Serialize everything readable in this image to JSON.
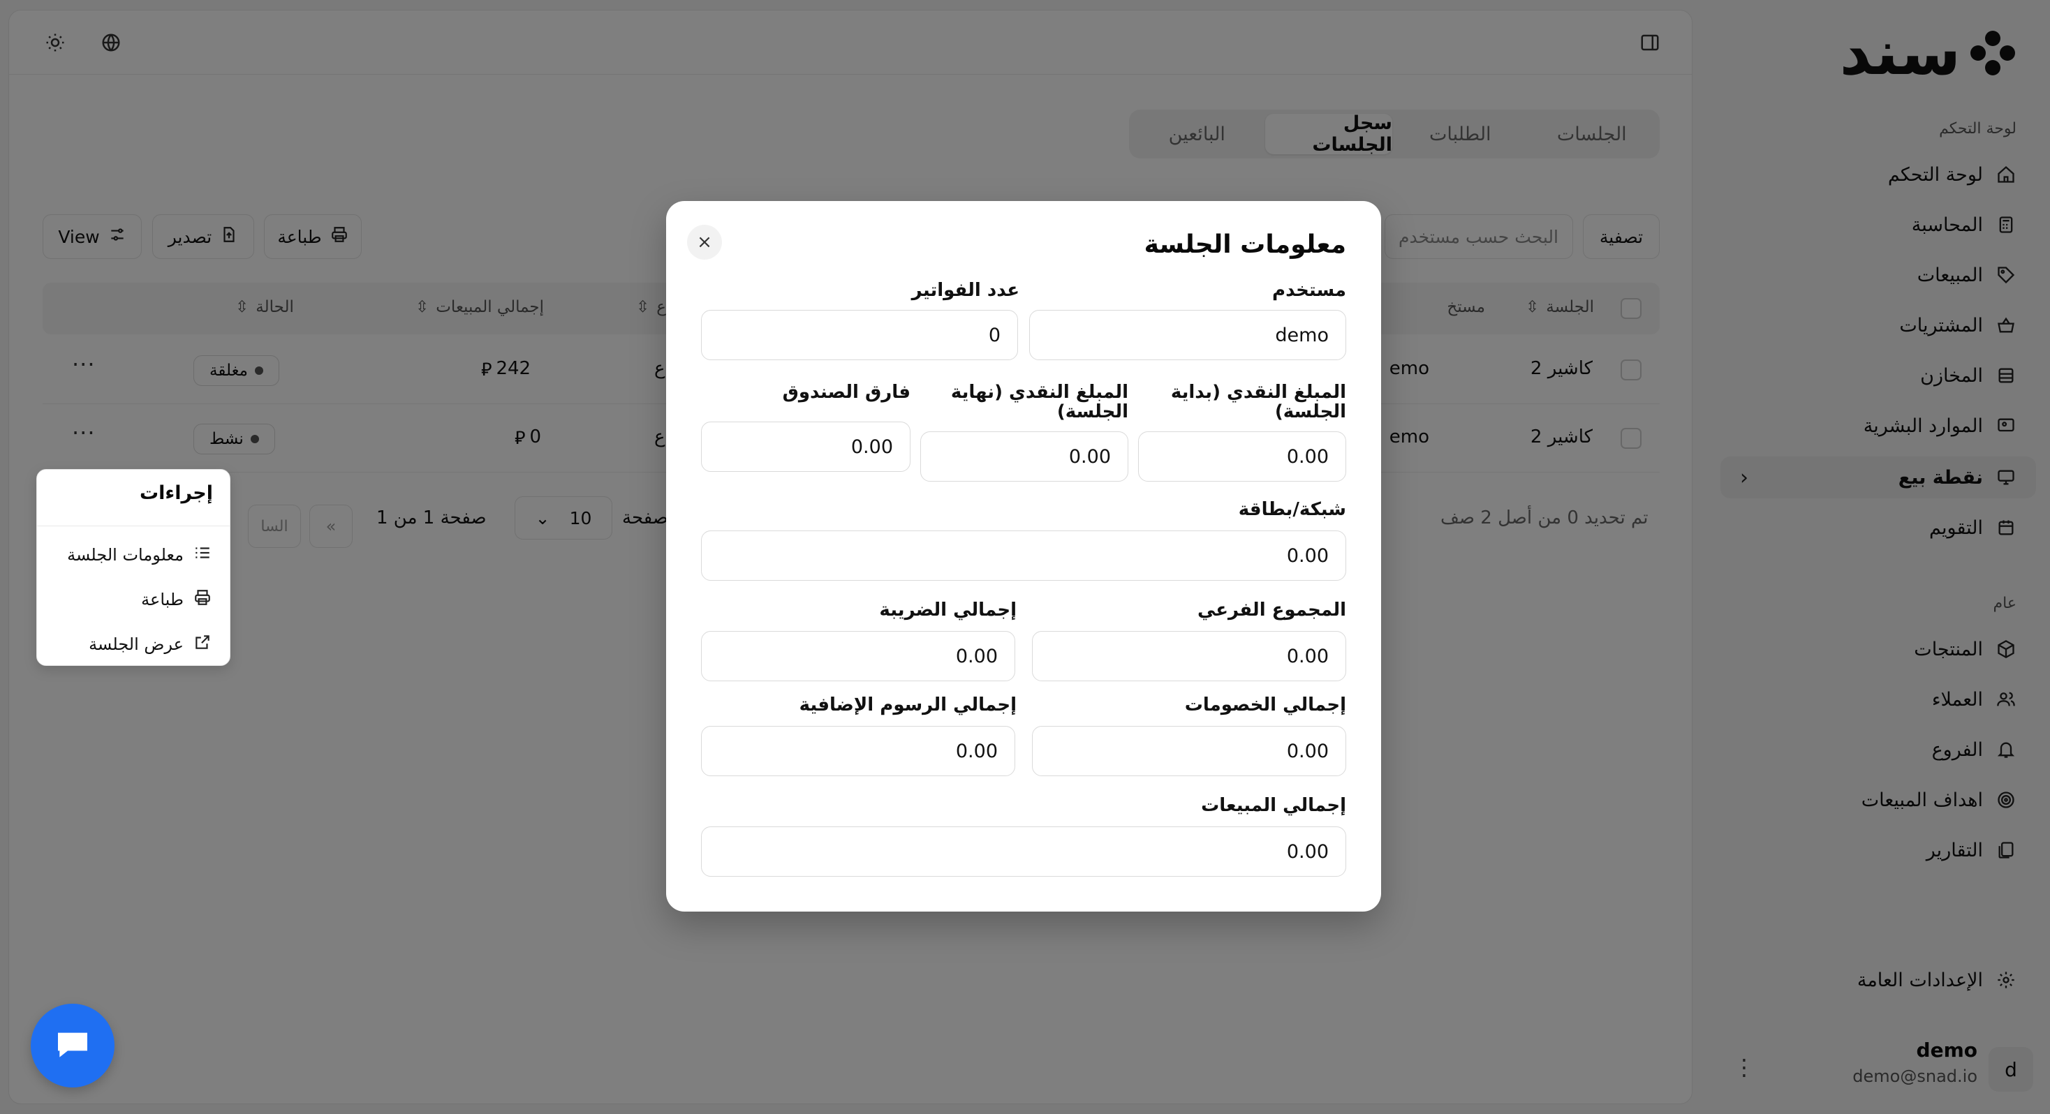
{
  "brand": {
    "logo_text": "سند"
  },
  "sidebar": {
    "group_dashboard_label": "لوحة التحكم",
    "group_general_label": "عام",
    "items": [
      {
        "label": "لوحة التحكم",
        "icon": "home-icon"
      },
      {
        "label": "المحاسبة",
        "icon": "calculator-icon"
      },
      {
        "label": "المبيعات",
        "icon": "tag-icon"
      },
      {
        "label": "المشتريات",
        "icon": "basket-icon"
      },
      {
        "label": "المخازن",
        "icon": "warehouse-icon"
      },
      {
        "label": "الموارد البشرية",
        "icon": "hr-icon"
      },
      {
        "label": "نقطة بيع",
        "icon": "monitor-icon",
        "active": true
      },
      {
        "label": "التقويم",
        "icon": "calendar-icon"
      }
    ],
    "general_items": [
      {
        "label": "المنتجات",
        "icon": "box-icon"
      },
      {
        "label": "العملاء",
        "icon": "users-icon"
      },
      {
        "label": "الفروع",
        "icon": "branch-icon"
      },
      {
        "label": "اهداف المبيعات",
        "icon": "target-icon"
      },
      {
        "label": "التقارير",
        "icon": "reports-icon"
      }
    ],
    "settings_label": "الإعدادات العامة",
    "user": {
      "initial": "d",
      "name": "demo",
      "email": "demo@snad.io"
    }
  },
  "tabs": [
    {
      "label": "الجلسات"
    },
    {
      "label": "الطلبات"
    },
    {
      "label": "سجل الجلسات",
      "active": true
    },
    {
      "label": "البائعين"
    }
  ],
  "toolbar": {
    "filter_label": "تصفية",
    "search_placeholder": "البحث حسب مستخدم",
    "print_label": "طباعة",
    "export_label": "تصدير",
    "view_label": "View"
  },
  "table": {
    "headers": {
      "session": "الجلسة",
      "user": "مستخ",
      "col3": "ع",
      "total_sales": "إجمالي المبيعات",
      "status": "الحالة"
    },
    "rows": [
      {
        "session": "كاشير 2",
        "user": "emo",
        "col3": "ع",
        "total_sales": "242",
        "status": "مغلقة"
      },
      {
        "session": "كاشير 2",
        "user": "emo",
        "col3": "ع",
        "total_sales": "0",
        "status": "نشط"
      }
    ],
    "currency_symbol": "⃁"
  },
  "pager": {
    "selected_text": "تم تحديد 0 من أصل 2 صف",
    "rows_per_page_label": "صفحة",
    "rows_per_page_value": "10",
    "page_text": "صفحة 1 من 1",
    "prev_label": "السا"
  },
  "actions_menu": {
    "title": "إجراءات",
    "items": [
      {
        "label": "معلومات الجلسة",
        "icon": "list-icon"
      },
      {
        "label": "طباعة",
        "icon": "printer-icon"
      },
      {
        "label": "عرض الجلسة",
        "icon": "external-link-icon"
      }
    ]
  },
  "modal": {
    "title": "معلومات الجلسة",
    "close_glyph": "×",
    "fields": {
      "user_label": "مستخدم",
      "user_value": "demo",
      "invoices_label": "عدد الفواتير",
      "invoices_value": "0",
      "cash_start_label": "المبلغ النقدي (بداية الجلسة)",
      "cash_start_value": "0.00",
      "cash_end_label": "المبلغ النقدي (نهاية الجلسة)",
      "cash_end_value": "0.00",
      "drawer_diff_label": "فارق الصندوق",
      "drawer_diff_value": "0.00",
      "card_label": "شبكة/بطاقة",
      "card_value": "0.00",
      "subtotal_label": "المجموع الفرعي",
      "subtotal_value": "0.00",
      "tax_label": "إجمالي الضريبة",
      "tax_value": "0.00",
      "discounts_label": "إجمالي الخصومات",
      "discounts_value": "0.00",
      "fees_label": "إجمالي الرسوم الإضافية",
      "fees_value": "0.00",
      "sales_label": "إجمالي المبيعات",
      "sales_value": "0.00"
    }
  },
  "colors": {
    "accent": "#1f6ff2",
    "overlay": "rgba(0,0,0,0.5)"
  }
}
